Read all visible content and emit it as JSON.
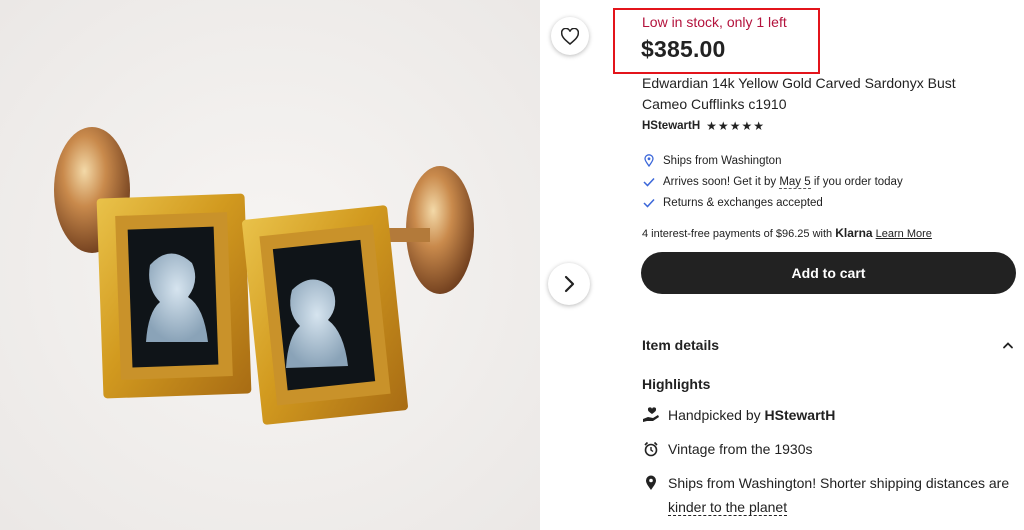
{
  "product": {
    "stock_status": "Low in stock, only 1 left",
    "price": "$385.00",
    "title": "Edwardian 14k Yellow Gold Carved Sardonyx Bust Cameo Cufflinks c1910",
    "shop_name": "HStewartH",
    "rating_stars": 5,
    "favorite_icon": "heart-outline-icon",
    "next_icon": "chevron-right-icon"
  },
  "shipping": {
    "ships_from": "Ships from Washington",
    "arrives_prefix": "Arrives soon! Get it by ",
    "arrives_date": "May 5",
    "arrives_suffix": " if you order today",
    "returns": "Returns & exchanges accepted"
  },
  "klarna": {
    "text": "4 interest-free payments of $96.25 with ",
    "brand": "Klarna",
    "learn_more": "Learn More"
  },
  "actions": {
    "add_to_cart": "Add to cart"
  },
  "details": {
    "section_title": "Item details",
    "highlights_title": "Highlights",
    "handpicked_prefix": "Handpicked by ",
    "handpicked_shop": "HStewartH",
    "vintage": "Vintage from the 1930s",
    "ships_note_prefix": "Ships from Washington! Shorter shipping distances are ",
    "ships_note_link": "kinder to the planet"
  },
  "colors": {
    "stock_red": "#b3123c",
    "highlight_border": "#e3141b",
    "button_dark": "#222222"
  }
}
